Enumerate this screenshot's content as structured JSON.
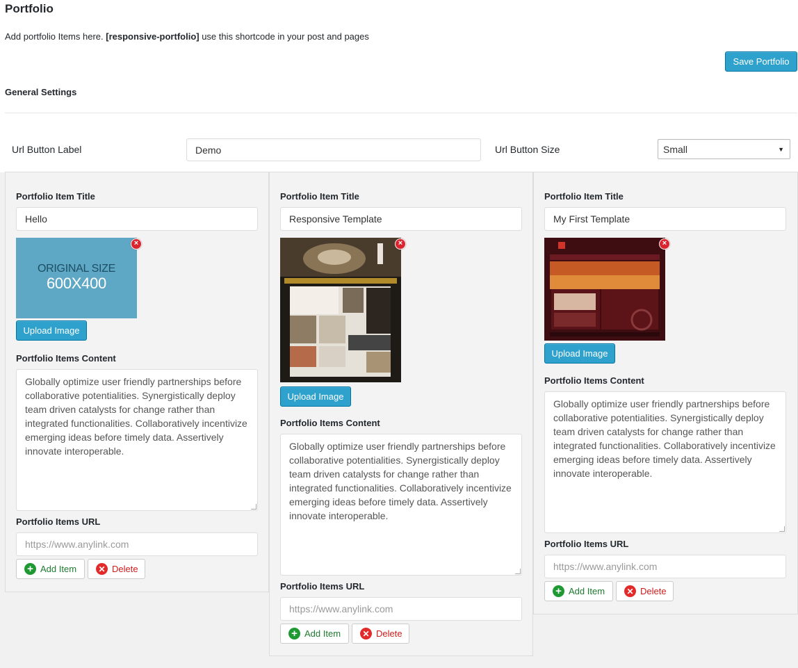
{
  "page": {
    "title": "Portfolio",
    "intro_prefix": "Add portfolio Items here. ",
    "shortcode": "[responsive-portfolio]",
    "intro_suffix": " use this shortcode in your post and pages",
    "save_label": "Save Portfolio"
  },
  "general": {
    "title": "General Settings",
    "url_label_caption": "Url Button Label",
    "url_label_value": "Demo",
    "url_size_caption": "Url Button Size",
    "url_size_value": "Small"
  },
  "labels": {
    "item_title": "Portfolio Item Title",
    "content": "Portfolio Items Content",
    "url": "Portfolio Items URL",
    "upload": "Upload Image",
    "add": "Add Item",
    "delete": "Delete",
    "url_placeholder": "https://www.anylink.com"
  },
  "items": [
    {
      "title": "Hello",
      "image": "placeholder-image",
      "image_text_1": "ORIGINAL SIZE",
      "image_text_2": "600X400",
      "content": "Globally optimize user friendly partnerships before collaborative potentialities. Synergistically deploy team driven catalysts for change rather than integrated functionalities. Collaboratively incentivize emerging ideas before timely data. Assertively innovate interoperable.",
      "url": ""
    },
    {
      "title": "Responsive Template",
      "image": "business-template-screenshot",
      "content": "Globally optimize user friendly partnerships before collaborative potentialities. Synergistically deploy team driven catalysts for change rather than integrated functionalities. Collaboratively incentivize emerging ideas before timely data. Assertively innovate interoperable.",
      "url": ""
    },
    {
      "title": "My First Template",
      "image": "church-template-screenshot",
      "content": "Globally optimize user friendly partnerships before collaborative potentialities. Synergistically deploy team driven catalysts for change rather than integrated functionalities. Collaboratively incentivize emerging ideas before timely data. Assertively innovate interoperable.",
      "url": ""
    }
  ],
  "colors": {
    "primary_button": "#2ea2cc",
    "add_green": "#1f9a33",
    "delete_red": "#e22a2a"
  }
}
